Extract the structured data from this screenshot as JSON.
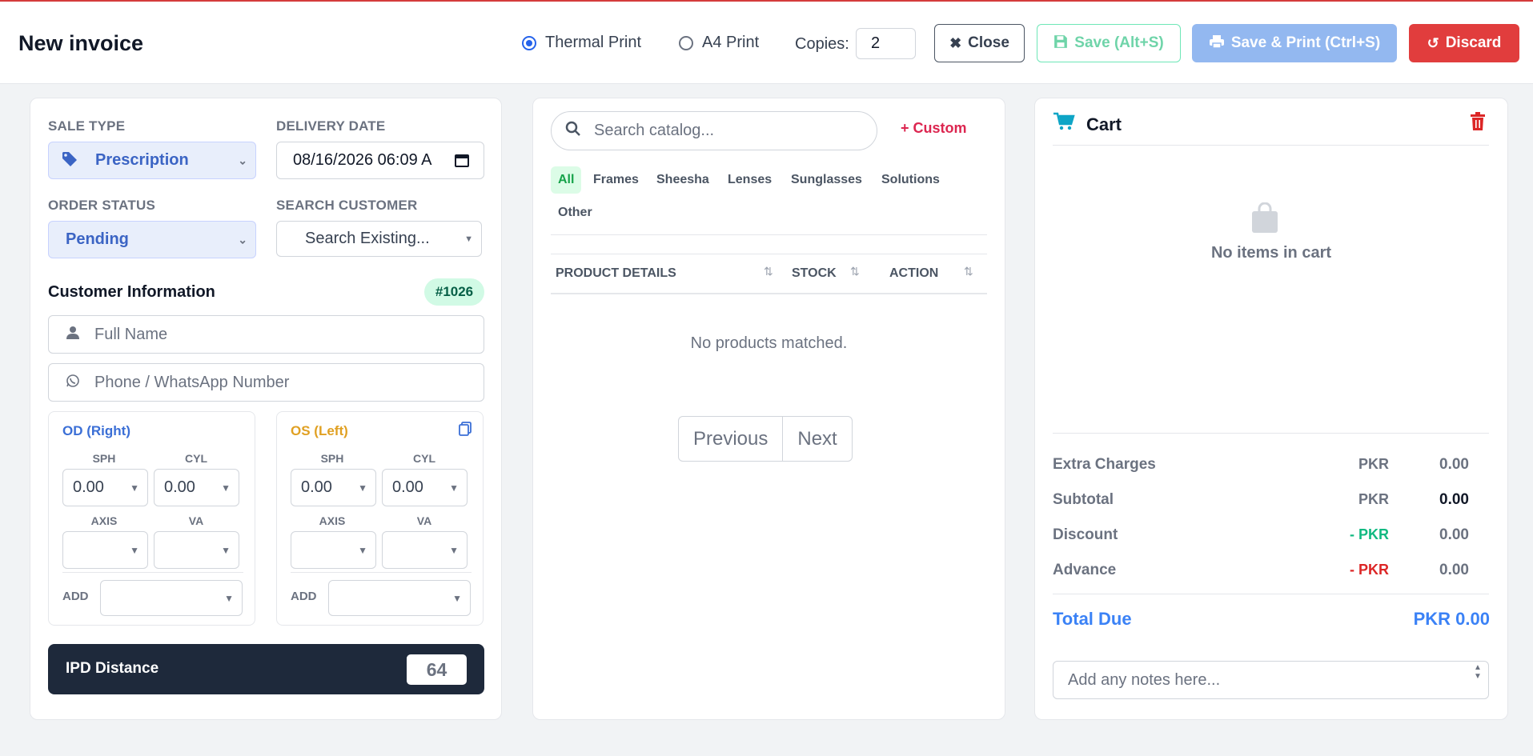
{
  "header": {
    "title": "New invoice",
    "print_options": [
      {
        "label": "Thermal Print",
        "selected": true
      },
      {
        "label": "A4 Print",
        "selected": false
      }
    ],
    "copies_label": "Copies:",
    "copies_value": "2",
    "close_label": "Close",
    "save_label": "Save (Alt+S)",
    "save_print_label": "Save & Print (Ctrl+S)",
    "discard_label": "Discard"
  },
  "form": {
    "sale_type_label": "SALE TYPE",
    "sale_type_value": "Prescription",
    "delivery_date_label": "DELIVERY DATE",
    "delivery_date_value": "08/16/2026 06:09 A",
    "order_status_label": "ORDER STATUS",
    "order_status_value": "Pending",
    "search_customer_label": "SEARCH CUSTOMER",
    "search_customer_value": "Search Existing...",
    "customer_info_title": "Customer Information",
    "customer_id_badge": "#1026",
    "full_name_placeholder": "Full Name",
    "phone_placeholder": "Phone / WhatsApp Number",
    "od": {
      "title": "OD (Right)",
      "sph_label": "SPH",
      "sph_value": "0.00",
      "cyl_label": "CYL",
      "cyl_value": "0.00",
      "axis_label": "AXIS",
      "axis_value": "",
      "va_label": "VA",
      "va_value": "",
      "add_label": "ADD",
      "add_value": ""
    },
    "os": {
      "title": "OS (Left)",
      "sph_label": "SPH",
      "sph_value": "0.00",
      "cyl_label": "CYL",
      "cyl_value": "0.00",
      "axis_label": "AXIS",
      "axis_value": "",
      "va_label": "VA",
      "va_value": "",
      "add_label": "ADD",
      "add_value": ""
    },
    "ipd_label": "IPD Distance",
    "ipd_value": "64"
  },
  "catalog": {
    "search_placeholder": "Search catalog...",
    "custom_label": "Custom",
    "categories": [
      "All",
      "Frames",
      "Sheesha",
      "Lenses",
      "Sunglasses",
      "Solutions",
      "Other"
    ],
    "active_category": "All",
    "columns": [
      "PRODUCT DETAILS",
      "STOCK",
      "ACTION"
    ],
    "empty_message": "No products matched.",
    "prev_label": "Previous",
    "next_label": "Next"
  },
  "cart": {
    "title": "Cart",
    "empty_message": "No items in cart",
    "rows": [
      {
        "label": "Extra Charges",
        "currency": "PKR",
        "value": "0.00"
      },
      {
        "label": "Subtotal",
        "currency": "PKR",
        "value": "0.00"
      },
      {
        "label": "Discount",
        "currency": "- PKR",
        "value": "0.00"
      },
      {
        "label": "Advance",
        "currency": "- PKR",
        "value": "0.00"
      }
    ],
    "total_label": "Total Due",
    "total_value": "PKR 0.00",
    "notes_placeholder": "Add any notes here..."
  },
  "colors": {
    "accent_blue": "#3b82f6",
    "discount_green": "#10b981",
    "advance_red": "#dc2626",
    "discard_red": "#e13d3d",
    "od_blue": "#3b6fd6",
    "os_orange": "#e0a022"
  },
  "icons": [
    "close-icon",
    "save-icon",
    "print-icon",
    "undo-icon",
    "tag-icon",
    "user-icon",
    "whatsapp-icon",
    "copy-icon",
    "search-icon",
    "plus-icon",
    "sort-icon",
    "cart-icon",
    "trash-icon",
    "bag-icon"
  ]
}
